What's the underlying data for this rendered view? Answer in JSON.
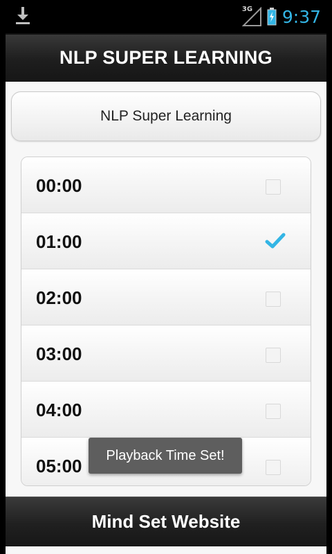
{
  "status_bar": {
    "network_label": "3G",
    "clock": "9:37",
    "icons": [
      "download-icon",
      "signal-icon",
      "battery-icon"
    ],
    "accent_color": "#33b5e5"
  },
  "app": {
    "title": "NLP SUPER LEARNING",
    "header_button_label": "NLP Super Learning",
    "time_items": [
      {
        "label": "00:00",
        "checked": false
      },
      {
        "label": "01:00",
        "checked": true
      },
      {
        "label": "02:00",
        "checked": false
      },
      {
        "label": "03:00",
        "checked": false
      },
      {
        "label": "04:00",
        "checked": false
      },
      {
        "label": "05:00",
        "checked": false
      }
    ],
    "toast": "Playback Time Set!",
    "footer_button_label": "Mind Set Website"
  }
}
